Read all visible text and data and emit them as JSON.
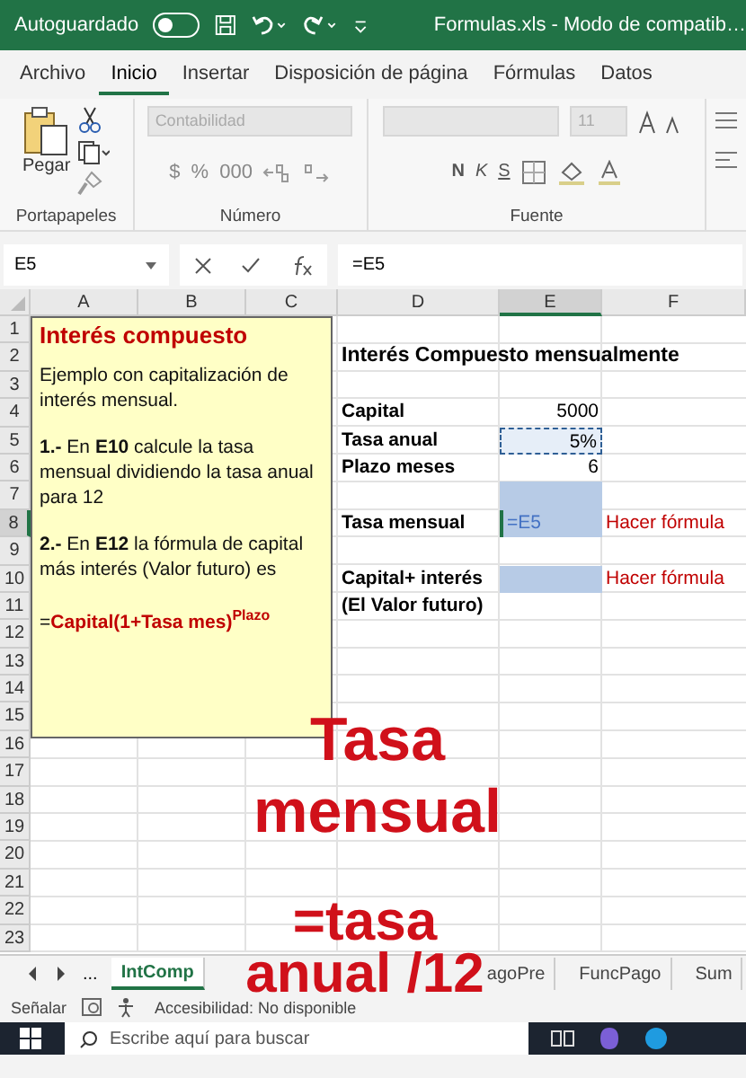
{
  "title_bar": {
    "autosave_label": "Autoguardado",
    "autosave_on": false,
    "filename": "Formulas.xls  -  Modo de compatib…"
  },
  "menu_tabs": [
    {
      "label": "Archivo",
      "selected": false
    },
    {
      "label": "Inicio",
      "selected": true
    },
    {
      "label": "Insertar",
      "selected": false
    },
    {
      "label": "Disposición de página",
      "selected": false
    },
    {
      "label": "Fórmulas",
      "selected": false
    },
    {
      "label": "Datos",
      "selected": false
    }
  ],
  "ribbon": {
    "paste_label": "Pegar",
    "number_format": "Contabilidad",
    "font_size": "11",
    "number_buttons": [
      "$",
      "%",
      "000"
    ],
    "font_buttons": [
      "N",
      "K",
      "S"
    ],
    "groups": [
      "Portapapeles",
      "Número",
      "Fuente"
    ]
  },
  "formula_bar": {
    "name_box": "E5",
    "formula": "=E5"
  },
  "columns": [
    {
      "label": "A",
      "selected": false
    },
    {
      "label": "B",
      "selected": false
    },
    {
      "label": "C",
      "selected": false
    },
    {
      "label": "D",
      "selected": false
    },
    {
      "label": "E",
      "selected": true
    },
    {
      "label": "F",
      "selected": false
    }
  ],
  "rows": [
    {
      "label": "1",
      "selected": false
    },
    {
      "label": "2",
      "selected": false,
      "d": {
        "kind": "heading",
        "text": "Interés Compuesto mensualmente"
      }
    },
    {
      "label": "3",
      "selected": false
    },
    {
      "label": "4",
      "selected": false,
      "d": {
        "kind": "label",
        "text": "Capital"
      },
      "e": {
        "kind": "number",
        "text": "5000"
      }
    },
    {
      "label": "5",
      "selected": false,
      "d": {
        "kind": "label",
        "text": "Tasa anual"
      },
      "e": {
        "kind": "copied",
        "text": "5%"
      }
    },
    {
      "label": "6",
      "selected": false,
      "d": {
        "kind": "label",
        "text": "Plazo meses"
      },
      "e": {
        "kind": "number",
        "text": "6"
      }
    },
    {
      "label": "7",
      "selected": false,
      "e": {
        "kind": "fill"
      }
    },
    {
      "label": "8",
      "selected": true,
      "d": {
        "kind": "label",
        "text": "Tasa mensual"
      },
      "e": {
        "kind": "editing",
        "text": "=E5"
      },
      "f": {
        "kind": "note",
        "text": "Hacer fórmula"
      }
    },
    {
      "label": "9",
      "selected": false
    },
    {
      "label": "10",
      "selected": false,
      "d": {
        "kind": "label",
        "text": "Capital+ interés"
      },
      "e": {
        "kind": "fill"
      },
      "f": {
        "kind": "note",
        "text": "Hacer fórmula"
      }
    },
    {
      "label": "11",
      "selected": false,
      "d": {
        "kind": "label",
        "text": "(El Valor futuro)"
      }
    },
    {
      "label": "12",
      "selected": false
    },
    {
      "label": "13",
      "selected": false
    },
    {
      "label": "14",
      "selected": false
    },
    {
      "label": "15",
      "selected": false
    },
    {
      "label": "16",
      "selected": false
    },
    {
      "label": "17",
      "selected": false
    },
    {
      "label": "18",
      "selected": false
    },
    {
      "label": "19",
      "selected": false
    },
    {
      "label": "20",
      "selected": false
    },
    {
      "label": "21",
      "selected": false
    },
    {
      "label": "22",
      "selected": false
    },
    {
      "label": "23",
      "selected": false
    }
  ],
  "comment_box": {
    "title": "Interés compuesto",
    "paragraphs": [
      "Ejemplo con capitalización de interés  mensual.",
      "**1.-** En **E10** calcule la tasa mensual dividiendo la tasa anual para 12",
      "**2.-** En **E12** la fórmula de capital más interés (Valor futuro) es"
    ],
    "formula": {
      "prefix": "=",
      "main": "Capital(1+Tasa mes)",
      "exponent": "Plazo"
    }
  },
  "overlay_captions": [
    "Tasa mensual",
    "=tasa anual /12"
  ],
  "sheet_tabs": {
    "more": "...",
    "tabs": [
      {
        "label": "IntComp",
        "selected": true
      },
      {
        "label": "agoPre",
        "selected": false
      },
      {
        "label": "FuncPago",
        "selected": false
      },
      {
        "label": "Sum",
        "selected": false
      }
    ]
  },
  "status_bar": {
    "mode": "Señalar",
    "accessibility": "Accesibilidad: No disponible"
  },
  "taskbar": {
    "search_placeholder": "Escribe aquí para buscar"
  }
}
